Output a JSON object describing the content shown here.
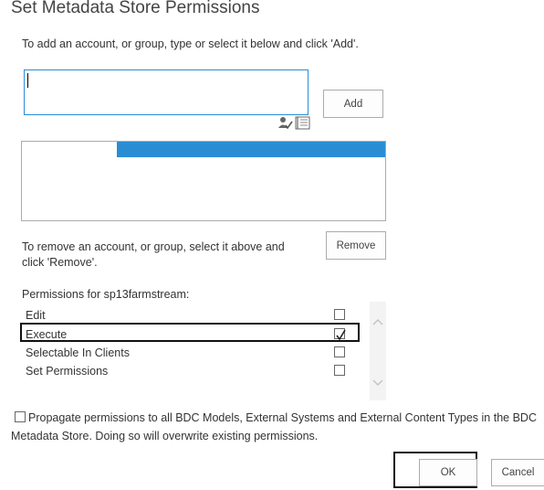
{
  "dialog": {
    "title": "Set Metadata Store Permissions"
  },
  "add_section": {
    "instruction": "To add an account, or group, type or select it below and click 'Add'.",
    "input_value": "",
    "add_button": "Add"
  },
  "remove_section": {
    "instruction_line1": "To remove an account, or group, select it above and",
    "instruction_line2": "click 'Remove'.",
    "remove_button": "Remove"
  },
  "permissions": {
    "header": "Permissions for sp13farmstream:",
    "items": [
      {
        "label": "Edit",
        "checked": false
      },
      {
        "label": "Execute",
        "checked": true
      },
      {
        "label": "Selectable In Clients",
        "checked": false
      },
      {
        "label": "Set Permissions",
        "checked": false
      }
    ]
  },
  "propagate": {
    "line1": "Propagate permissions to all BDC Models, External Systems and External Content Types in the BDC",
    "line2": "Metadata Store. Doing so will overwrite existing permissions.",
    "checked": false
  },
  "footer": {
    "ok_button": "OK",
    "cancel_button": "Cancel"
  },
  "icons": {
    "check_names": "check-names-icon",
    "browse": "address-book-icon",
    "scroll_up": "chevron-up-icon",
    "scroll_down": "chevron-down-icon",
    "checkmark": "checkmark-icon"
  },
  "colors": {
    "accent": "#2a8dd4",
    "title": "#444444",
    "border": "#ababab"
  }
}
